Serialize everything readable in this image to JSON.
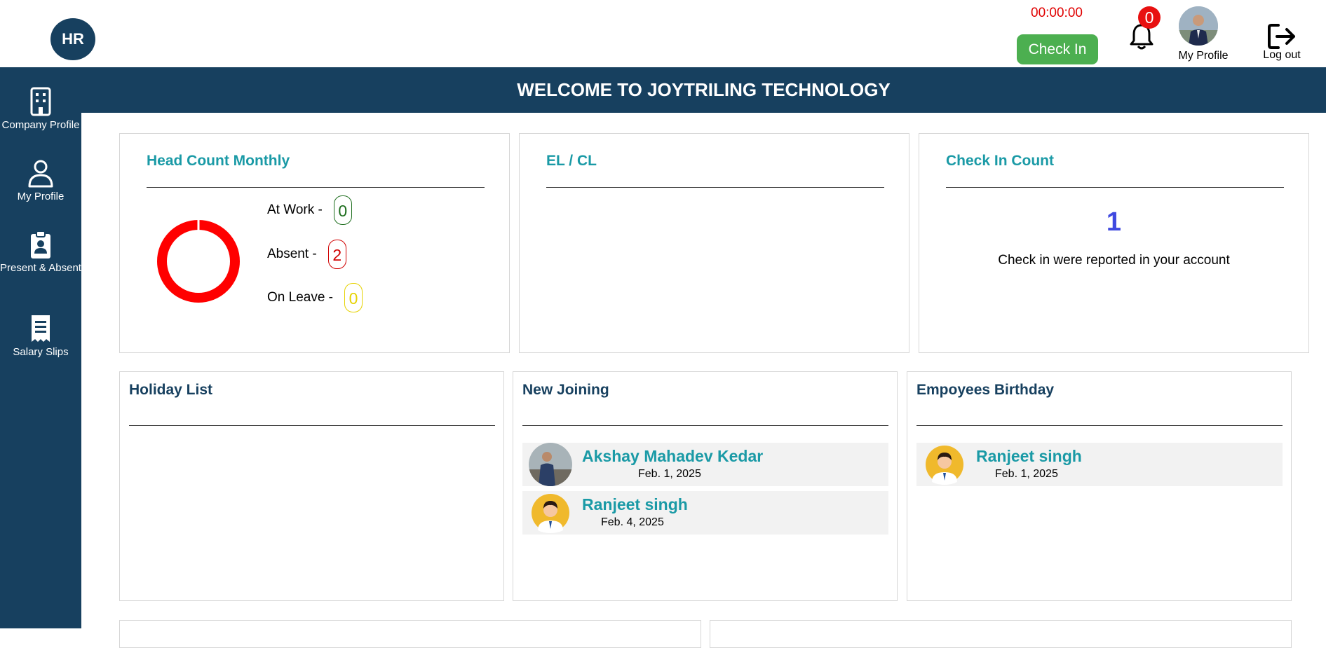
{
  "header": {
    "logo_text": "HR",
    "timer": "00:00:00",
    "check_in_label": "Check In",
    "notification_count": "0",
    "profile_label": "My Profile",
    "logout_label": "Log out"
  },
  "sidebar": {
    "items": [
      {
        "label": "Company Profile",
        "icon": "building-icon"
      },
      {
        "label": "My Profile",
        "icon": "user-icon"
      },
      {
        "label": "Present & Absent",
        "icon": "clipboard-user-icon"
      },
      {
        "label": "Salary Slips",
        "icon": "receipt-icon"
      }
    ]
  },
  "banner": {
    "title": "WELCOME TO JOYTRILING TECHNOLOGY"
  },
  "head_count": {
    "title": "Head Count Monthly",
    "at_work_label": "At Work -",
    "at_work_value": "0",
    "absent_label": "Absent -",
    "absent_value": "2",
    "on_leave_label": "On Leave -",
    "on_leave_value": "0"
  },
  "el_cl": {
    "title": "EL / CL"
  },
  "check_in_count": {
    "title": "Check In Count",
    "count": "1",
    "text": "Check in were reported in your account"
  },
  "holiday_list": {
    "title": "Holiday List"
  },
  "new_joining": {
    "title": "New Joining",
    "people": [
      {
        "name": "Akshay Mahadev Kedar",
        "date": "Feb. 1, 2025"
      },
      {
        "name": "Ranjeet singh",
        "date": "Feb. 4, 2025"
      }
    ]
  },
  "birthdays": {
    "title": "Empoyees Birthday",
    "people": [
      {
        "name": "Ranjeet singh",
        "date": "Feb. 1, 2025"
      }
    ]
  },
  "colors": {
    "navy": "#17405f",
    "teal": "#1a9aa6",
    "check_in_green": "#4caf50",
    "alert_red": "#e81010"
  }
}
